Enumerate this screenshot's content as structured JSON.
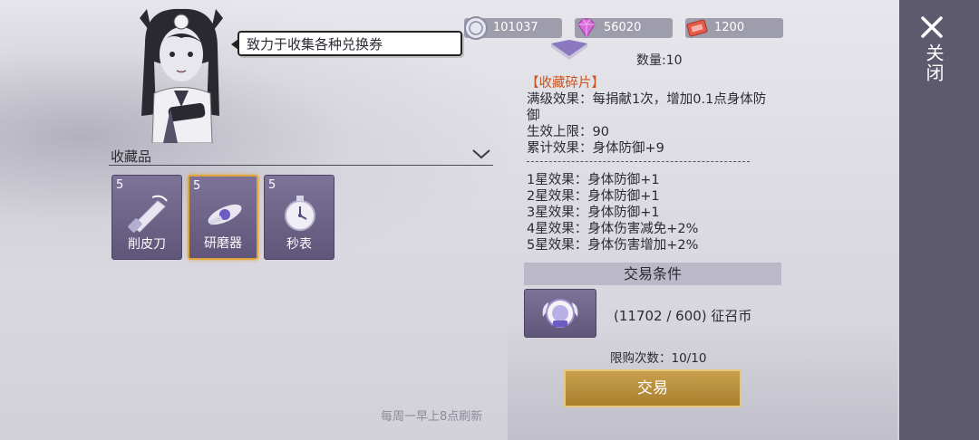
{
  "speech": "致力于收集各种兑换券",
  "collection": {
    "title": "收藏品",
    "items": [
      {
        "count": "5",
        "name": "削皮刀",
        "icon": "peeler-knife-icon",
        "selected": false
      },
      {
        "count": "5",
        "name": "研磨器",
        "icon": "grinder-icon",
        "selected": true
      },
      {
        "count": "5",
        "name": "秒表",
        "icon": "stopwatch-icon",
        "selected": false
      }
    ]
  },
  "refresh_note": "每周一早上8点刷新",
  "currencies": [
    {
      "icon": "silver-coin-icon",
      "value": "101037"
    },
    {
      "icon": "diamond-icon",
      "value": "56020"
    },
    {
      "icon": "ticket-icon",
      "value": "1200"
    }
  ],
  "detail": {
    "quantity": "数量:10",
    "fragment_title": "【收藏碎片】",
    "full_effect_1": "满级效果：每捐献1次，增加0.1点身体防",
    "full_effect_2": "御",
    "limit": "生效上限：90",
    "cumulative": "累计效果：身体防御+9",
    "stars": [
      "1星效果：身体防御+1",
      "2星效果：身体防御+1",
      "3星效果：身体防御+1",
      "4星效果：身体伤害减免+2%",
      "5星效果：身体伤害增加+2%"
    ]
  },
  "trade": {
    "header": "交易条件",
    "cost": "(11702 / 600) 征召币",
    "purchase_limit": "限购次数：10/10",
    "button": "交易"
  },
  "close_label": "关闭",
  "colors": {
    "accent": "#c8a04e",
    "fragment": "#c8541f",
    "item_bg": "#6e6589",
    "sidebar": "#5d5a70"
  }
}
